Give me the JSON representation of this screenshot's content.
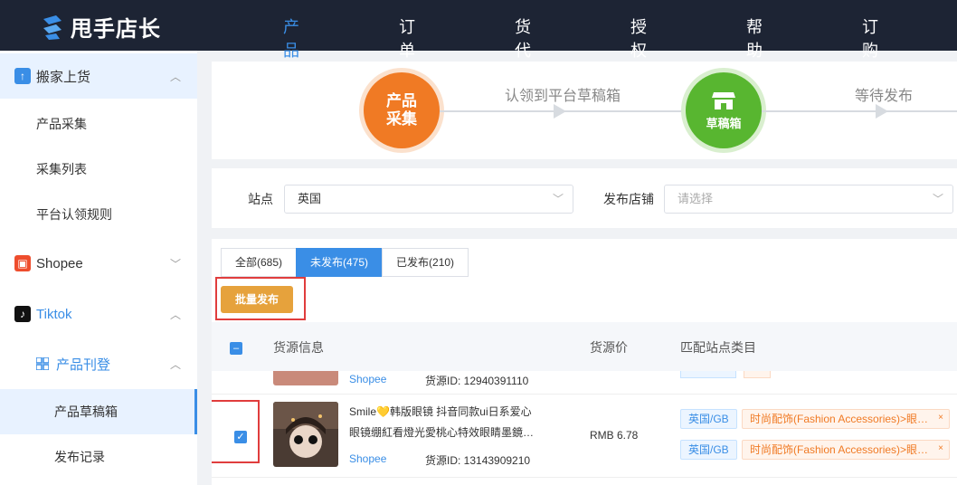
{
  "app": {
    "logo_text": "甩手店长"
  },
  "nav": [
    "产品",
    "订单",
    "货代",
    "授权",
    "帮助",
    "订购"
  ],
  "sidebar": {
    "group1": "搬家上货",
    "group1_items": [
      "产品采集",
      "采集列表",
      "平台认领规则"
    ],
    "group2": "Shopee",
    "group3": "Tiktok",
    "subgroup": "产品刊登",
    "subgroup_items": [
      "产品草稿箱",
      "发布记录"
    ]
  },
  "steps": {
    "step1_line1": "产品",
    "step1_line2": "采集",
    "arrow1_text": "认领到平台草稿箱",
    "step2_label": "草稿箱",
    "arrow2_text": "等待发布"
  },
  "filter": {
    "site_label": "站点",
    "site_value": "英国",
    "store_label": "发布店铺",
    "store_placeholder": "请选择"
  },
  "tabs": [
    "全部(685)",
    "未发布(475)",
    "已发布(210)"
  ],
  "batch_button": "批量发布",
  "table": {
    "headers": [
      "货源信息",
      "货源价",
      "匹配站点类目"
    ],
    "partial_row": {
      "source": "Shopee",
      "source_id": "货源ID:  12940391110"
    },
    "row": {
      "title_line1": "Smile💛韩版眼镜 抖音同款ui日系爱心",
      "title_line2": "眼镜绷紅看燈光愛桃心特效眼睛墨鏡…",
      "source": "Shopee",
      "source_id": "货源ID:  13143909210",
      "price": "RMB 6.78",
      "site1": "英国/GB",
      "category1": "时尚配饰(Fashion Accessories)>眼…",
      "site2": "英国/GB",
      "category2": "时尚配饰(Fashion Accessories)>眼…",
      "close_glyph": "×"
    }
  },
  "colors": {
    "accent": "#3a8ee6",
    "orange": "#f07a24",
    "green": "#58b630",
    "batch": "#e6a23c",
    "highlight_box": "#e03d3d"
  }
}
